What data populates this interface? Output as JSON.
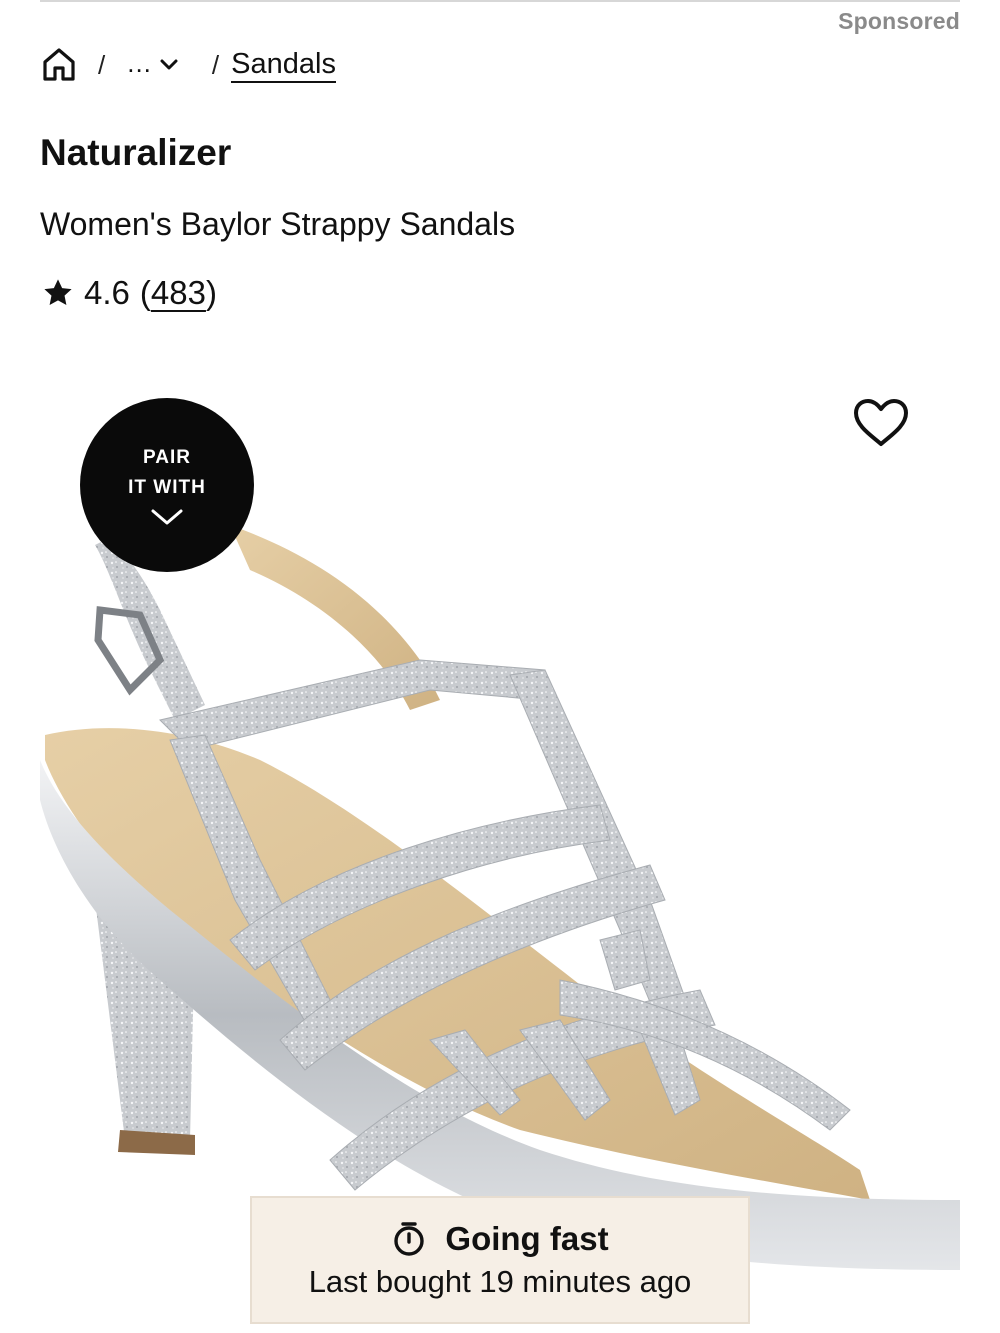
{
  "sponsored_label": "Sponsored",
  "breadcrumb": {
    "ellipsis": "...",
    "current": "Sandals"
  },
  "product": {
    "brand": "Naturalizer",
    "name": "Women's Baylor Strappy Sandals",
    "rating": "4.6",
    "review_count": "483",
    "image_alt": "Silver glitter strappy high-heel sandal"
  },
  "pair_badge": {
    "line1": "PAIR",
    "line2": "IT WITH"
  },
  "urgency": {
    "title": "Going fast",
    "subtitle": "Last bought 19 minutes ago"
  },
  "icons": {
    "home": "home-icon",
    "chevron": "chevron-down-icon",
    "star": "star-icon",
    "favorite": "heart-icon",
    "timer": "stopwatch-icon"
  },
  "colors": {
    "text": "#111111",
    "muted": "#8a8a8a",
    "badge_bg": "#0a0a0a",
    "urgency_bg": "#f6efe6",
    "glitter_silver": "#c9ccd0",
    "insole_tan": "#d9bf93"
  }
}
